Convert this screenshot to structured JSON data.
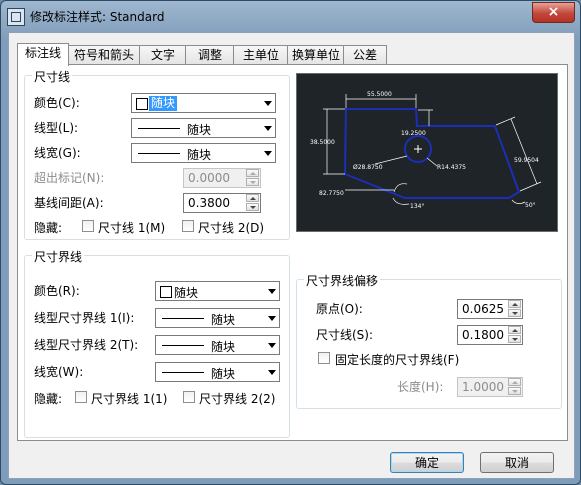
{
  "window": {
    "title": "修改标注样式: Standard",
    "close_label": "×"
  },
  "tabs": [
    {
      "label": "标注线"
    },
    {
      "label": "符号和箭头"
    },
    {
      "label": "文字"
    },
    {
      "label": "调整"
    },
    {
      "label": "主单位"
    },
    {
      "label": "换算单位"
    },
    {
      "label": "公差"
    }
  ],
  "dim_line": {
    "title": "尺寸线",
    "color": {
      "label": "颜色(C):",
      "value": "随块"
    },
    "linetype": {
      "label": "线型(L):",
      "value": "随块"
    },
    "lineweight": {
      "label": "线宽(G):",
      "value": "随块"
    },
    "extend": {
      "label": "超出标记(N):",
      "value": "0.0000"
    },
    "baseline": {
      "label": "基线间距(A):",
      "value": "0.3800"
    },
    "suppress": {
      "label": "隐藏:",
      "line1": "尺寸线 1(M)",
      "line2": "尺寸线 2(D)"
    }
  },
  "ext_line": {
    "title": "尺寸界线",
    "color": {
      "label": "颜色(R):",
      "value": "随块"
    },
    "linetype1": {
      "label": "线型尺寸界线 1(I):",
      "value": "随块"
    },
    "linetype2": {
      "label": "线型尺寸界线 2(T):",
      "value": "随块"
    },
    "lineweight": {
      "label": "线宽(W):",
      "value": "随块"
    },
    "suppress": {
      "label": "隐藏:",
      "ext1": "尺寸界线 1(1)",
      "ext2": "尺寸界线 2(2)"
    }
  },
  "offset": {
    "title": "尺寸界线偏移",
    "origin": {
      "label": "原点(O):",
      "value": "0.0625"
    },
    "dimline": {
      "label": "尺寸线(S):",
      "value": "0.1800"
    },
    "fixed": {
      "label": "固定长度的尺寸界线(F)"
    },
    "length": {
      "label": "长度(H):",
      "value": "1.0000"
    }
  },
  "preview": {
    "dims": {
      "top": "55.5000",
      "left": "38.5000",
      "inner": "19.2500",
      "diag": "59.9504",
      "dia": "Ø28.8750",
      "rad": "R14.4375",
      "bottom": "82.7750",
      "ang1": "134°",
      "ang2": "50°"
    }
  },
  "buttons": {
    "ok": "确定",
    "cancel": "取消"
  },
  "colors": {
    "preview_bg": "#1f2428",
    "shape": "#1a2fb5",
    "accent": "#3399ff"
  }
}
